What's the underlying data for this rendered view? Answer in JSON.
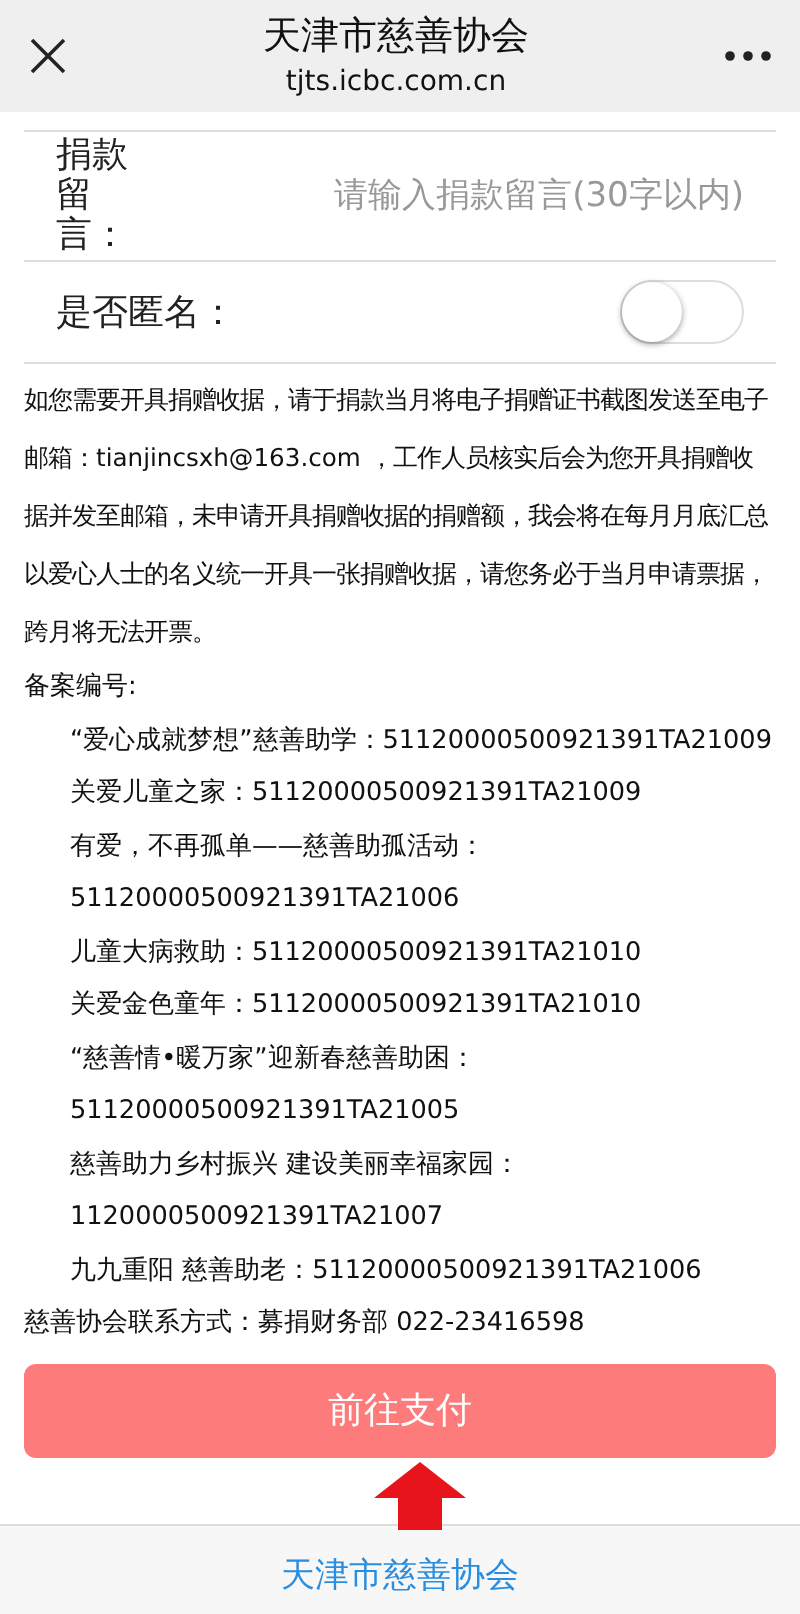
{
  "header": {
    "title": "天津市慈善协会",
    "subtitle": "tjts.icbc.com.cn"
  },
  "message": {
    "label": "捐款留言：",
    "placeholder": "请输入捐款留言(30字以内)"
  },
  "anonymous": {
    "label": "是否匿名：",
    "on": false
  },
  "notice": "如您需要开具捐赠收据，请于捐款当月将电子捐赠证书截图发送至电子邮箱：tianjincsxh@163.com ，工作人员核实后会为您开具捐赠收据并发至邮箱，未申请开具捐赠收据的捐赠额，我会将在每月月底汇总以爱心人士的名义统一开具一张捐赠收据，请您务必于当月申请票据，跨月将无法开票。",
  "records_heading": "备案编号:",
  "records": [
    "“爱心成就梦想”慈善助学：51120000500921391TA21009",
    "关爱儿童之家：51120000500921391TA21009",
    "有爱，不再孤单——慈善助孤活动：",
    "51120000500921391TA21006",
    "儿童大病救助：51120000500921391TA21010",
    "关爱金色童年：51120000500921391TA21010",
    "“慈善情•暖万家”迎新春慈善助困：",
    "51120000500921391TA21005",
    "慈善助力乡村振兴 建设美丽幸福家园：",
    "1120000500921391TA21007",
    "九九重阳 慈善助老：51120000500921391TA21006"
  ],
  "contact": "慈善协会联系方式：募捐财务部 022-23416598",
  "pay_button": "前往支付",
  "footer": "天津市慈善协会"
}
